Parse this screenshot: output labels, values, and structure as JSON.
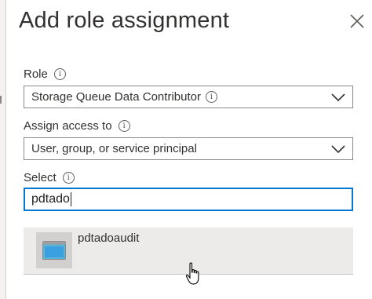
{
  "dialog": {
    "title": "Add role assignment",
    "close_icon": "close-icon"
  },
  "role": {
    "label": "Role",
    "info_icon": "info-icon",
    "value": "Storage Queue Data Contributor",
    "value_info_icon": "info-icon",
    "chevron_icon": "chevron-down-icon"
  },
  "assign_access": {
    "label": "Assign access to",
    "info_icon": "info-icon",
    "value": "User, group, or service principal",
    "chevron_icon": "chevron-down-icon"
  },
  "select": {
    "label": "Select",
    "info_icon": "info-icon",
    "value": "pdtado"
  },
  "results": [
    {
      "name": "pdtadoaudit",
      "icon": "app-window-icon"
    }
  ],
  "colors": {
    "accent": "#0078d4",
    "result_bg": "#edebe9"
  }
}
